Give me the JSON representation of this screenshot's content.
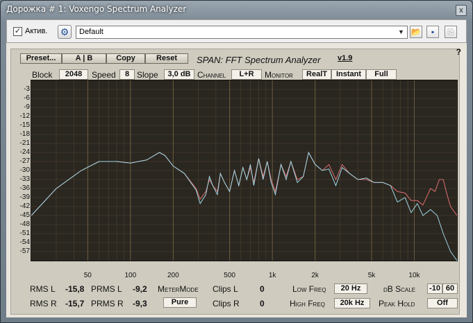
{
  "window": {
    "title": "Дорожка # 1: Voxengo Spectrum Analyzer",
    "close": "x"
  },
  "host": {
    "active_label": "Актив.",
    "active_checked": "✓",
    "preset_value": "Default",
    "help": "?"
  },
  "toolbar": {
    "preset": "Preset...",
    "ab": "A | B",
    "copy": "Copy",
    "reset": "Reset",
    "plugin_title": "SPAN: FFT Spectrum Analyzer",
    "version": "v1.9"
  },
  "settings": {
    "block_label": "Block",
    "block_value": "2048",
    "speed_label": "Speed",
    "speed_value": "8",
    "slope_label": "Slope",
    "slope_value": "3,0 dB",
    "channel_label": "Channel",
    "channel_value": "L+R",
    "monitor_label": "Monitor",
    "realt": "RealT",
    "instant": "Instant",
    "full": "Full"
  },
  "y_axis": [
    "-3",
    "-6",
    "-9",
    "-12",
    "-15",
    "-18",
    "-21",
    "-24",
    "-27",
    "-30",
    "-33",
    "-36",
    "-39",
    "-42",
    "-45",
    "-48",
    "-51",
    "-54",
    "-57"
  ],
  "x_axis": [
    {
      "label": "50",
      "hz": 50
    },
    {
      "label": "100",
      "hz": 100
    },
    {
      "label": "200",
      "hz": 200
    },
    {
      "label": "500",
      "hz": 500
    },
    {
      "label": "1k",
      "hz": 1000
    },
    {
      "label": "2k",
      "hz": 2000
    },
    {
      "label": "5k",
      "hz": 5000
    },
    {
      "label": "10k",
      "hz": 10000
    }
  ],
  "meters": {
    "rms_l_label": "RMS  L",
    "rms_l": "-15,8",
    "rms_r_label": "RMS  R",
    "rms_r": "-15,7",
    "prms_l_label": "PRMS  L",
    "prms_l": "-9,2",
    "prms_r_label": "PRMS  R",
    "prms_r": "-9,3",
    "metermode_label": "MeterMode",
    "metermode_value": "Pure",
    "clips_l_label": "Clips  L",
    "clips_l": "0",
    "clips_r_label": "Clips  R",
    "clips_r": "0",
    "low_freq_label": "Low  Freq",
    "low_freq": "20 Hz",
    "high_freq_label": "High  Freq",
    "high_freq": "20k Hz",
    "db_scale_label": "dB  Scale",
    "db_scale_min": "-10",
    "db_scale_max": "60",
    "peak_hold_label": "Peak  Hold",
    "peak_hold": "Off"
  },
  "colors": {
    "left_channel": "#e07070",
    "right_channel": "#9fd8e6",
    "grid": "#6b5e3d"
  },
  "spectrum": {
    "db_min": -60,
    "db_max": 0,
    "f_min": 20,
    "f_max": 20000,
    "right": [
      [
        20,
        -45
      ],
      [
        30,
        -36
      ],
      [
        45,
        -30
      ],
      [
        60,
        -27
      ],
      [
        80,
        -27
      ],
      [
        100,
        -27.5
      ],
      [
        130,
        -26.5
      ],
      [
        160,
        -24
      ],
      [
        175,
        -25
      ],
      [
        200,
        -28.5
      ],
      [
        240,
        -31
      ],
      [
        290,
        -36.5
      ],
      [
        310,
        -41
      ],
      [
        340,
        -38
      ],
      [
        360,
        -32
      ],
      [
        380,
        -35
      ],
      [
        410,
        -38
      ],
      [
        430,
        -31
      ],
      [
        460,
        -34
      ],
      [
        500,
        -37
      ],
      [
        540,
        -30
      ],
      [
        580,
        -35
      ],
      [
        620,
        -29
      ],
      [
        660,
        -33
      ],
      [
        700,
        -28
      ],
      [
        740,
        -35
      ],
      [
        800,
        -26
      ],
      [
        860,
        -33
      ],
      [
        920,
        -27
      ],
      [
        980,
        -34
      ],
      [
        1050,
        -38
      ],
      [
        1150,
        -28
      ],
      [
        1250,
        -33
      ],
      [
        1350,
        -27
      ],
      [
        1500,
        -34
      ],
      [
        1650,
        -32
      ],
      [
        1800,
        -24
      ],
      [
        2000,
        -28
      ],
      [
        2250,
        -30
      ],
      [
        2500,
        -29.5
      ],
      [
        2800,
        -35
      ],
      [
        3100,
        -29
      ],
      [
        3500,
        -31
      ],
      [
        4000,
        -33
      ],
      [
        4600,
        -32.5
      ],
      [
        5200,
        -34
      ],
      [
        6000,
        -34
      ],
      [
        6800,
        -35
      ],
      [
        7600,
        -40.5
      ],
      [
        8600,
        -39
      ],
      [
        9500,
        -44
      ],
      [
        10500,
        -41
      ],
      [
        11500,
        -45
      ],
      [
        13000,
        -43
      ],
      [
        14500,
        -45
      ],
      [
        16000,
        -51
      ],
      [
        18000,
        -57
      ],
      [
        20000,
        -60
      ]
    ],
    "left": [
      [
        20,
        -45
      ],
      [
        30,
        -36
      ],
      [
        45,
        -30
      ],
      [
        60,
        -27
      ],
      [
        80,
        -27
      ],
      [
        100,
        -27.5
      ],
      [
        130,
        -26.5
      ],
      [
        160,
        -24
      ],
      [
        175,
        -25
      ],
      [
        200,
        -28.5
      ],
      [
        240,
        -31
      ],
      [
        290,
        -36
      ],
      [
        310,
        -39.5
      ],
      [
        340,
        -37
      ],
      [
        360,
        -33
      ],
      [
        380,
        -35
      ],
      [
        410,
        -37
      ],
      [
        430,
        -31
      ],
      [
        460,
        -34
      ],
      [
        500,
        -37
      ],
      [
        540,
        -30
      ],
      [
        580,
        -35
      ],
      [
        620,
        -29
      ],
      [
        660,
        -33
      ],
      [
        700,
        -29
      ],
      [
        740,
        -34
      ],
      [
        800,
        -26
      ],
      [
        860,
        -32
      ],
      [
        920,
        -27
      ],
      [
        980,
        -33
      ],
      [
        1050,
        -37
      ],
      [
        1150,
        -28
      ],
      [
        1250,
        -32
      ],
      [
        1350,
        -27
      ],
      [
        1500,
        -33
      ],
      [
        1650,
        -32
      ],
      [
        1800,
        -24
      ],
      [
        2000,
        -28
      ],
      [
        2250,
        -30
      ],
      [
        2500,
        -28
      ],
      [
        2800,
        -33
      ],
      [
        3100,
        -28
      ],
      [
        3500,
        -31
      ],
      [
        4000,
        -33
      ],
      [
        4600,
        -33
      ],
      [
        5200,
        -34
      ],
      [
        6000,
        -34
      ],
      [
        6800,
        -35
      ],
      [
        7600,
        -37
      ],
      [
        8600,
        -37.5
      ],
      [
        9500,
        -40
      ],
      [
        10500,
        -40
      ],
      [
        11500,
        -41.5
      ],
      [
        13000,
        -36
      ],
      [
        14000,
        -37
      ],
      [
        15000,
        -33
      ],
      [
        16000,
        -33
      ],
      [
        17000,
        -38
      ],
      [
        18000,
        -42
      ],
      [
        20000,
        -45
      ]
    ]
  }
}
